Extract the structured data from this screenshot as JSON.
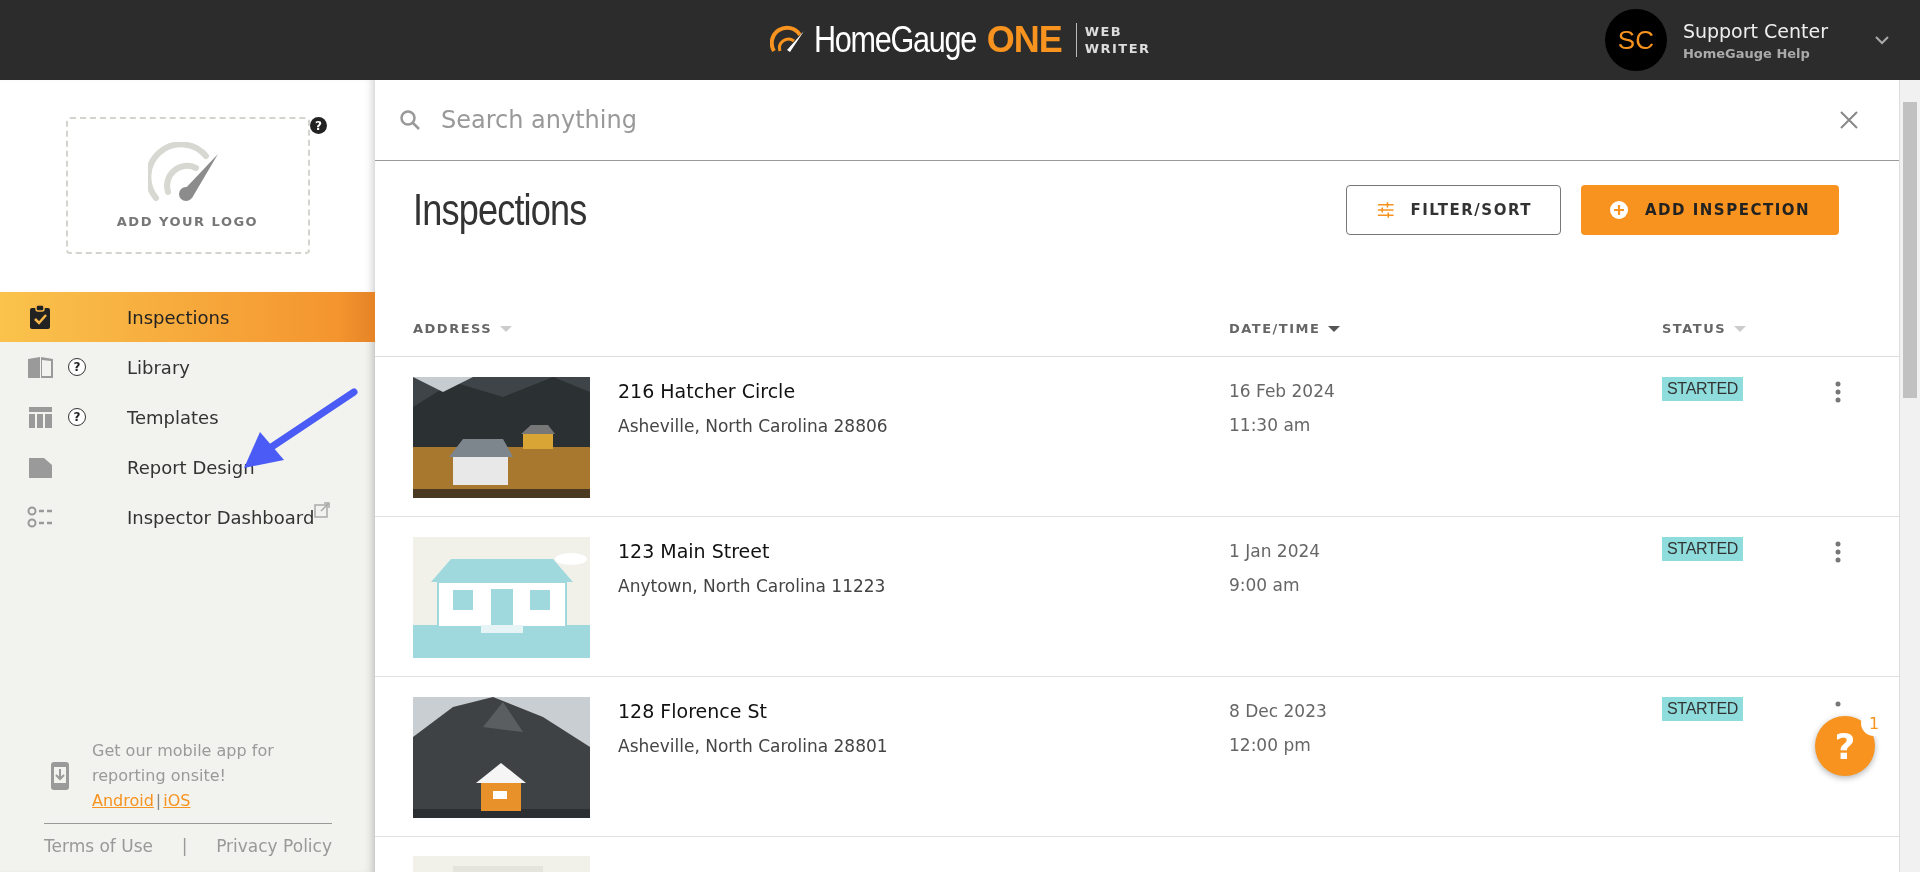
{
  "header": {
    "logo": {
      "brand": "HomeGauge",
      "brand_accent": "ONE",
      "product_line1": "WEB",
      "product_line2": "WRITER"
    },
    "user": {
      "initials": "SC",
      "name": "Support Center",
      "subtitle": "HomeGauge Help"
    }
  },
  "sidebar": {
    "logo_placeholder": {
      "label": "ADD YOUR LOGO",
      "help": "?"
    },
    "nav": [
      {
        "label": "Inspections",
        "selected": true,
        "external": false
      },
      {
        "label": "Library",
        "help": "?",
        "selected": false,
        "external": false
      },
      {
        "label": "Templates",
        "help": "?",
        "selected": false,
        "external": false
      },
      {
        "label": "Report Design",
        "selected": false,
        "external": false
      },
      {
        "label": "Inspector Dashboard",
        "selected": false,
        "external": true
      }
    ],
    "promo": {
      "text": "Get our mobile app for reporting onsite!",
      "links": [
        "Android",
        "iOS"
      ],
      "separator": "|"
    },
    "footer_links": [
      "Terms of Use",
      "Privacy Policy"
    ],
    "footer_separator": "|"
  },
  "search": {
    "placeholder": "Search anything"
  },
  "page": {
    "title": "Inspections",
    "buttons": [
      {
        "label": "FILTER/SORT",
        "kind": "outline"
      },
      {
        "label": "ADD INSPECTION",
        "kind": "primary"
      }
    ]
  },
  "table": {
    "columns": [
      {
        "label": "ADDRESS",
        "sorted": false
      },
      {
        "label": "DATE/TIME",
        "sorted": true
      },
      {
        "label": "STATUS",
        "sorted": false
      }
    ],
    "rows": [
      {
        "kind": "full",
        "street": "216 Hatcher Circle",
        "city": "Asheville, North Carolina 28806",
        "date": "16 Feb 2024",
        "time": "11:30 am",
        "status": "STARTED"
      },
      {
        "kind": "full",
        "street": "123 Main Street",
        "city": "Anytown, North Carolina 11223",
        "date": "1 Jan 2024",
        "time": "9:00 am",
        "status": "STARTED"
      },
      {
        "kind": "full",
        "street": "128 Florence St",
        "city": "Asheville, North Carolina 28801",
        "date": "8 Dec 2023",
        "time": "12:00 pm",
        "status": "STARTED"
      },
      {
        "kind": "partial"
      }
    ]
  },
  "help_button": {
    "glyph": "?",
    "badge": "1"
  },
  "annotations": [
    {
      "kind": "arrow",
      "color": "#4a5cf5"
    }
  ]
}
